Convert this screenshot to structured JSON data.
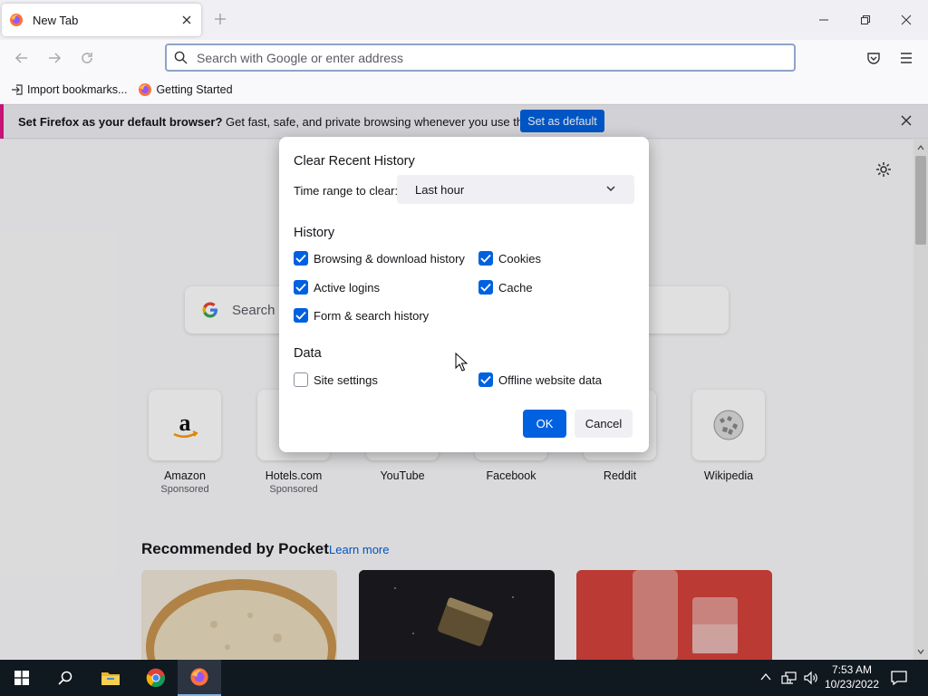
{
  "browser": {
    "tab_title": "New Tab",
    "url_placeholder": "Search with Google or enter address",
    "bookmarks": [
      {
        "label": "Import bookmarks..."
      },
      {
        "label": "Getting Started"
      }
    ]
  },
  "notification": {
    "bold": "Set Firefox as your default browser?",
    "text": " Get fast, safe, and private browsing whenever you use the web.",
    "button": "Set as default"
  },
  "newtab": {
    "search_placeholder": "Search",
    "sites": [
      {
        "name": "Amazon",
        "sub": "Sponsored"
      },
      {
        "name": "Hotels.com",
        "sub": "Sponsored"
      },
      {
        "name": "YouTube",
        "sub": ""
      },
      {
        "name": "Facebook",
        "sub": ""
      },
      {
        "name": "Reddit",
        "sub": ""
      },
      {
        "name": "Wikipedia",
        "sub": ""
      }
    ],
    "pocket_title": "Recommended by Pocket",
    "pocket_link": "Learn more"
  },
  "dialog": {
    "title": "Clear Recent History",
    "time_range_label": "Time range to clear:",
    "time_range_value": "Last hour",
    "history_heading": "History",
    "history_items": [
      {
        "label": "Browsing & download history",
        "checked": true
      },
      {
        "label": "Cookies",
        "checked": true
      },
      {
        "label": "Active logins",
        "checked": true
      },
      {
        "label": "Cache",
        "checked": true
      },
      {
        "label": "Form & search history",
        "checked": true
      }
    ],
    "data_heading": "Data",
    "data_items": [
      {
        "label": "Site settings",
        "checked": false
      },
      {
        "label": "Offline website data",
        "checked": true
      }
    ],
    "ok": "OK",
    "cancel": "Cancel"
  },
  "taskbar": {
    "time": "7:53 AM",
    "date": "10/23/2022"
  },
  "colors": {
    "accent": "#0061e0",
    "notification_stripe": "#e31587",
    "taskbar": "#101820"
  }
}
